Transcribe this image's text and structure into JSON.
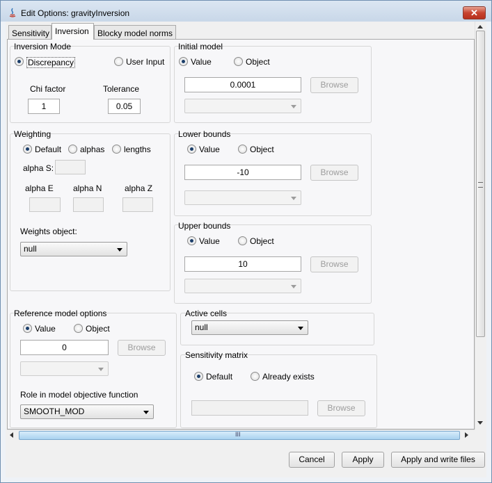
{
  "window": {
    "title": "Edit Options: gravityInversion",
    "close_icon": "close-icon"
  },
  "tabs": [
    {
      "label": "Sensitivity",
      "active": false
    },
    {
      "label": "Inversion",
      "active": true
    },
    {
      "label": "Blocky model norms",
      "active": false
    }
  ],
  "inversion_mode": {
    "label": "Inversion Mode",
    "discrepancy": "Discrepancy",
    "user_input": "User Input",
    "chi_factor_label": "Chi factor",
    "chi_factor": "1",
    "tolerance_label": "Tolerance",
    "tolerance": "0.05"
  },
  "initial_model": {
    "label": "Initial model",
    "value_label": "Value",
    "object_label": "Object",
    "value": "0.0001",
    "browse": "Browse"
  },
  "weighting": {
    "label": "Weighting",
    "default": "Default",
    "alphas": "alphas",
    "lengths": "lengths",
    "alpha_s": "alpha S:",
    "alpha_e": "alpha E",
    "alpha_n": "alpha N",
    "alpha_z": "alpha Z",
    "weights_object_label": "Weights object:",
    "weights_object": "null"
  },
  "lower_bounds": {
    "label": "Lower bounds",
    "value_label": "Value",
    "object_label": "Object",
    "value": "-10",
    "browse": "Browse"
  },
  "upper_bounds": {
    "label": "Upper bounds",
    "value_label": "Value",
    "object_label": "Object",
    "value": "10",
    "browse": "Browse"
  },
  "reference_model": {
    "label": "Reference model options",
    "value_label": "Value",
    "object_label": "Object",
    "value": "0",
    "browse": "Browse",
    "role_label": "Role in model objective function",
    "role": "SMOOTH_MOD"
  },
  "active_cells": {
    "label": "Active cells",
    "value": "null"
  },
  "sensitivity_matrix": {
    "label": "Sensitivity matrix",
    "default": "Default",
    "already_exists": "Already exists",
    "browse": "Browse"
  },
  "footer": {
    "cancel": "Cancel",
    "apply": "Apply",
    "apply_write": "Apply and write files"
  },
  "scrollbar": {
    "grip": "III"
  },
  "colors": {
    "title_gradient": "#c8d7e8",
    "close": "#c7432f",
    "scroll_thumb": "#a9d2f0",
    "radio_dot": "#1b3e6a"
  }
}
